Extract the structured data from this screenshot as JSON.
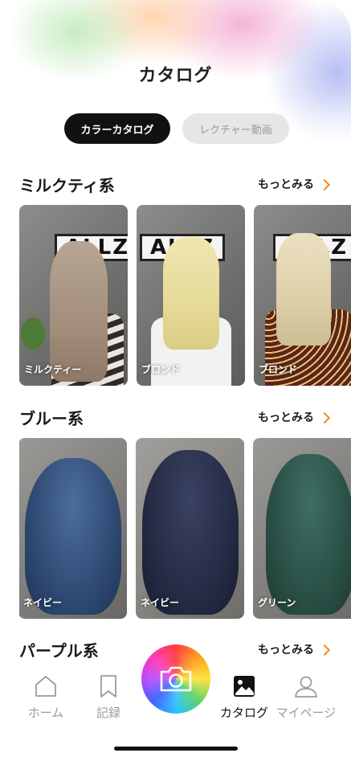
{
  "header": {
    "title": "カタログ"
  },
  "segments": {
    "active": "カラーカタログ",
    "inactive": "レクチャー動画"
  },
  "sections": [
    {
      "title": "ミルクティ系",
      "more": "もっとみる",
      "cards": [
        "ミルクティー",
        "ブロンド",
        "ブロンド"
      ]
    },
    {
      "title": "ブルー系",
      "more": "もっとみる",
      "cards": [
        "ネイビー",
        "ネイビー",
        "グリーン"
      ]
    },
    {
      "title": "パープル系",
      "more": "もっとみる"
    }
  ],
  "sign_text": "ALLZ",
  "tabs": {
    "home": "ホーム",
    "record": "記録",
    "catalog": "カタログ",
    "mypage": "マイページ"
  },
  "icons": {
    "more": "chevron-right-icon",
    "home": "home-icon",
    "record": "bookmark-icon",
    "camera": "camera-icon",
    "catalog": "image-icon",
    "mypage": "person-icon"
  },
  "colors": {
    "accent": "#f08a24",
    "active_tab": "#111111",
    "inactive_tab": "#9b9b9b"
  }
}
